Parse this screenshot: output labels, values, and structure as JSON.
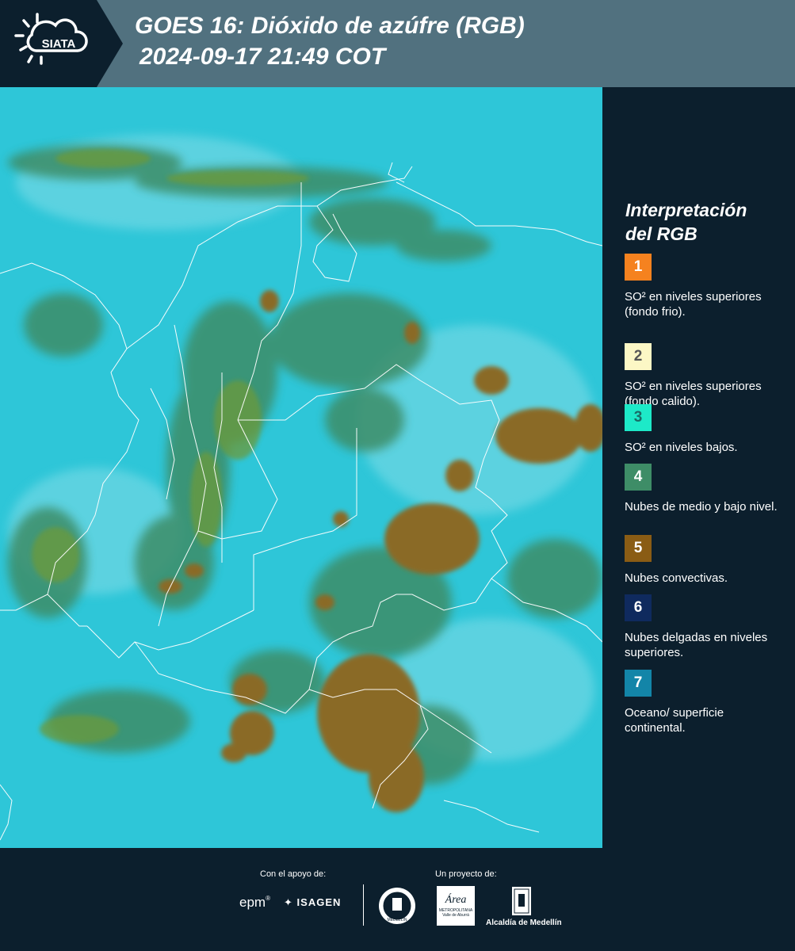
{
  "header": {
    "logo_text": "SIATA",
    "title_line1": "GOES 16: Dióxido de azúfre (RGB)",
    "title_line2": "2024-09-17 21:49 COT"
  },
  "legend": {
    "title_line1": "Interpretación",
    "title_line2": "del RGB",
    "items": [
      {
        "number": "1",
        "color": "#f5821f",
        "text_color": "#ffffff",
        "text": "SO² en niveles superiores (fondo frio)."
      },
      {
        "number": "2",
        "color": "#fcf7c5",
        "text_color": "#555555",
        "text": "SO² en niveles superiores (fondo calido)."
      },
      {
        "number": "3",
        "color": "#1de9c8",
        "text_color": "#1a6b66",
        "text": "SO² en niveles bajos."
      },
      {
        "number": "4",
        "color": "#3e8d67",
        "text_color": "#ffffff",
        "text": "Nubes de medio y bajo nivel."
      },
      {
        "number": "5",
        "color": "#8a5c14",
        "text_color": "#ffffff",
        "text": "Nubes convectivas."
      },
      {
        "number": "6",
        "color": "#0f2a5e",
        "text_color": "#ffffff",
        "text": "Nubes delgadas en niveles superiores."
      },
      {
        "number": "7",
        "color": "#1385a8",
        "text_color": "#ffffff",
        "text": "Oceano/ superficie continental."
      }
    ]
  },
  "map": {
    "background_color": "#2ec6d8",
    "cloud_colors": [
      "#3e8d67",
      "#8a6a28",
      "#6c9a3a"
    ]
  },
  "footer": {
    "support_label": "Con el apoyo de:",
    "project_label": "Un proyecto de:",
    "epm_logo": "epm",
    "isagen_logo": "ISAGEN",
    "area_logo_title": "Área",
    "area_logo_sub1": "METROPOLITANA",
    "area_logo_sub2": "Valle de Aburrá",
    "alcaldia_label": "Alcaldía de Medellín",
    "seal_text": "MEDELLÍN"
  }
}
